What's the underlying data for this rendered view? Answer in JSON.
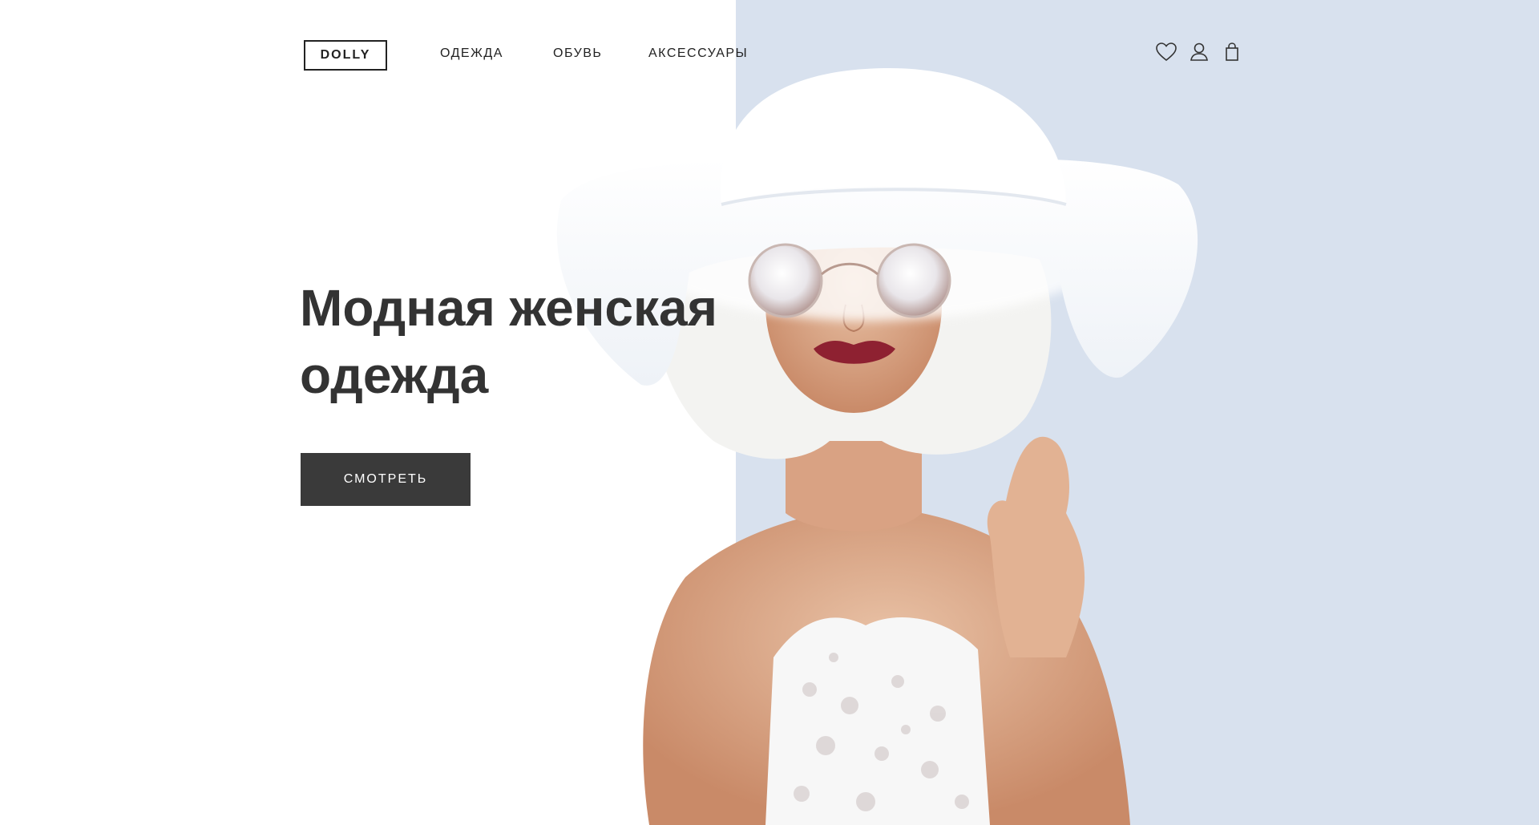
{
  "header": {
    "logo": "DOLLY",
    "nav": [
      {
        "label": "ОДЕЖДА"
      },
      {
        "label": "ОБУВЬ"
      },
      {
        "label": "АКСЕССУАРЫ"
      }
    ],
    "icons": [
      "heart-icon",
      "user-icon",
      "shopping-bag-icon"
    ]
  },
  "hero": {
    "title_line1": "Модная женская",
    "title_line2": "одежда",
    "cta_label": "СМОТРЕТЬ"
  },
  "colors": {
    "panel_bg": "#d8e1ee",
    "text": "#333333",
    "button_bg": "#3a3a3a",
    "button_text": "#ffffff"
  }
}
